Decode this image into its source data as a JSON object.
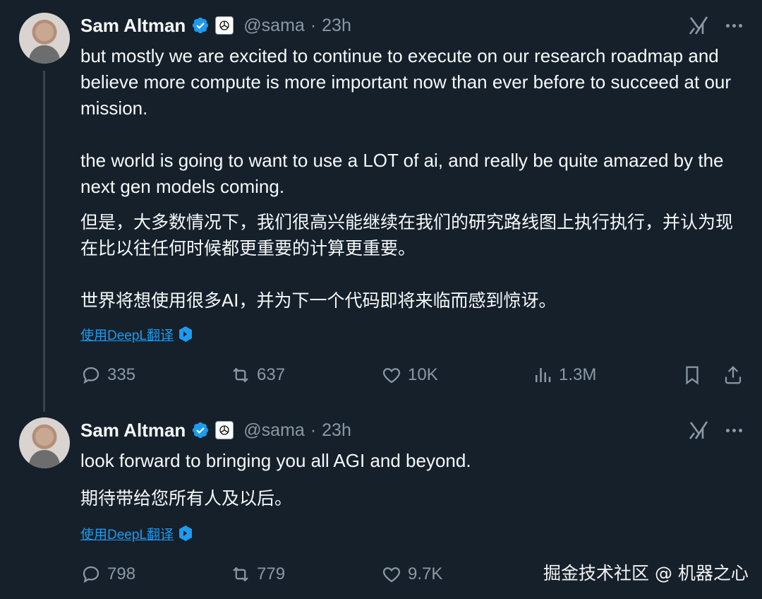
{
  "tweets": [
    {
      "author": {
        "name": "Sam Altman",
        "handle": "@sama",
        "time": "23h"
      },
      "separator": "·",
      "text_en": "but mostly we are excited to continue to execute on our research roadmap and believe more compute is more important now than ever before to succeed at our mission.\n\nthe world is going to want to use a LOT of ai, and really be quite amazed by the next gen models coming.",
      "text_zh": "但是，大多数情况下，我们很高兴能继续在我们的研究路线图上执行执行，并认为现在比以往任何时候都更重要的计算更重要。\n\n世界将想使用很多AI，并为下一个代码即将来临而感到惊讶。",
      "translate_label": "使用DeepL翻译",
      "stats": {
        "replies": "335",
        "reposts": "637",
        "likes": "10K",
        "views": "1.3M"
      }
    },
    {
      "author": {
        "name": "Sam Altman",
        "handle": "@sama",
        "time": "23h"
      },
      "separator": "·",
      "text_en": "look forward to bringing you all AGI and beyond.",
      "text_zh": "期待带给您所有人及以后。",
      "translate_label": "使用DeepL翻译",
      "stats": {
        "replies": "798",
        "reposts": "779",
        "likes": "9.7K"
      }
    }
  ],
  "watermark": "掘金技术社区 @ 机器之心",
  "icons": [
    "verified-badge-icon",
    "openai-affiliate-icon",
    "grok-icon",
    "more-icon",
    "deepl-icon",
    "reply-icon",
    "repost-icon",
    "like-icon",
    "views-icon",
    "bookmark-icon",
    "share-icon"
  ],
  "colors": {
    "background": "#15202b",
    "text": "#f7f9f9",
    "secondary": "#8b98a5",
    "accent": "#1d9bf0"
  }
}
